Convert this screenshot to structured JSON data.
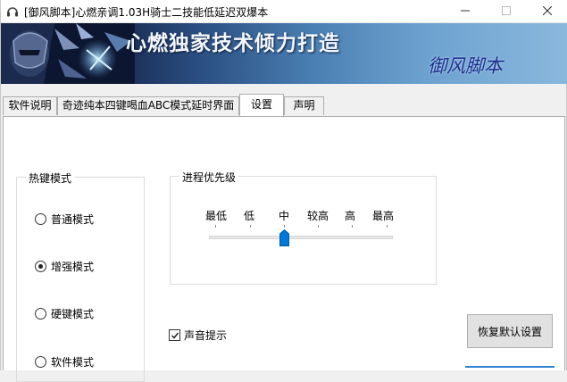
{
  "window": {
    "title": "[御风脚本]心燃亲调1.03H骑士二技能低延迟双爆本",
    "icons": {
      "app": "headset-icon",
      "minimize": "minimize-icon",
      "maximize": "maximize-icon",
      "close": "close-icon"
    }
  },
  "banner": {
    "slogan": "心燃独家技术倾力打造",
    "signature": "御风脚本",
    "image": "armored-knight-icon"
  },
  "tabs": [
    {
      "label": "软件说明",
      "active": false
    },
    {
      "label": "奇迹纯本四键喝血ABC模式延时界面",
      "active": false
    },
    {
      "label": "设置",
      "active": true
    },
    {
      "label": "声明",
      "active": false
    }
  ],
  "hotkey_group": {
    "title": "热键模式",
    "options": [
      {
        "label": "普通模式",
        "checked": false
      },
      {
        "label": "增强模式",
        "checked": true
      },
      {
        "label": "硬键模式",
        "checked": false
      },
      {
        "label": "软件模式",
        "checked": false
      }
    ]
  },
  "priority_group": {
    "title": "进程优先级",
    "levels": [
      "最低",
      "低",
      "中",
      "较高",
      "高",
      "最高"
    ],
    "selected_index": 2
  },
  "sound_prompt": {
    "label": "声音提示",
    "checked": true
  },
  "restore_button": {
    "label": "恢复默认设置"
  },
  "colors": {
    "accent": "#0078d7",
    "slogan": "#f4f8ff",
    "signature": "#1a2d8c"
  }
}
